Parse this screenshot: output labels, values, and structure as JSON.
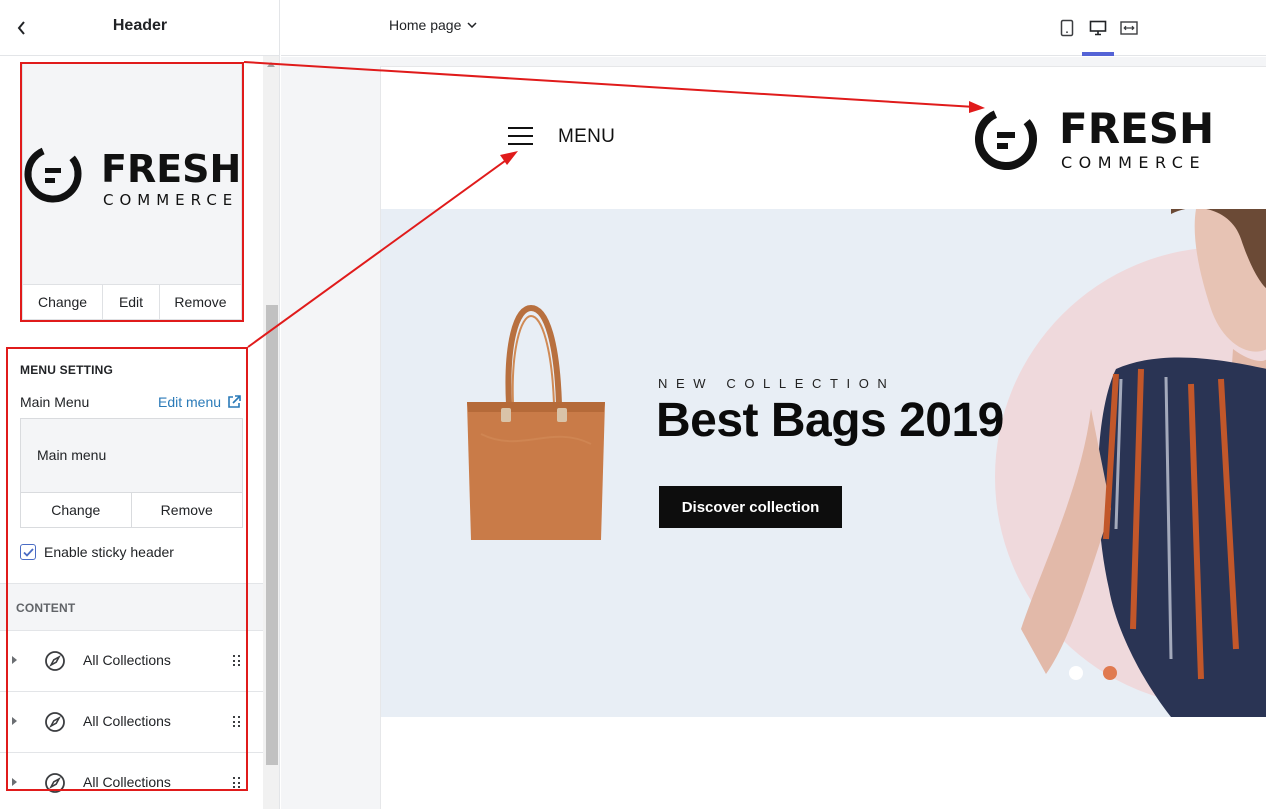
{
  "sidebar": {
    "title": "Header",
    "logo_actions": {
      "change": "Change",
      "edit": "Edit",
      "remove": "Remove"
    },
    "menu_setting": {
      "heading": "MENU SETTING",
      "field_label": "Main Menu",
      "edit_link": "Edit menu",
      "selected_menu": "Main menu",
      "change": "Change",
      "remove": "Remove",
      "sticky_label": "Enable sticky header",
      "sticky_checked": true
    },
    "content": {
      "heading": "CONTENT",
      "items": [
        {
          "label": "All Collections",
          "icon": "compass-icon"
        },
        {
          "label": "All Collections",
          "icon": "compass-icon"
        },
        {
          "label": "All Collections",
          "icon": "compass-icon"
        }
      ]
    }
  },
  "topbar": {
    "page_selector": "Home page",
    "views": [
      "mobile-view-icon",
      "desktop-view-icon",
      "full-width-view-icon"
    ],
    "active_view": "desktop"
  },
  "logo": {
    "word": "FRESH",
    "tagline": "COMMERCE"
  },
  "preview": {
    "menu_label": "MENU",
    "hero": {
      "eyebrow": "NEW COLLECTION",
      "title": "Best Bags 2019",
      "cta": "Discover collection",
      "slide_count": 2,
      "active_slide": 2
    }
  },
  "colors": {
    "accent": "#5463d6",
    "link": "#2a7ab8",
    "annotation": "#e01b1b",
    "hero_bg": "#e8eef5",
    "hero_circle": "#efd9dc",
    "slider_active": "#e07a50"
  }
}
